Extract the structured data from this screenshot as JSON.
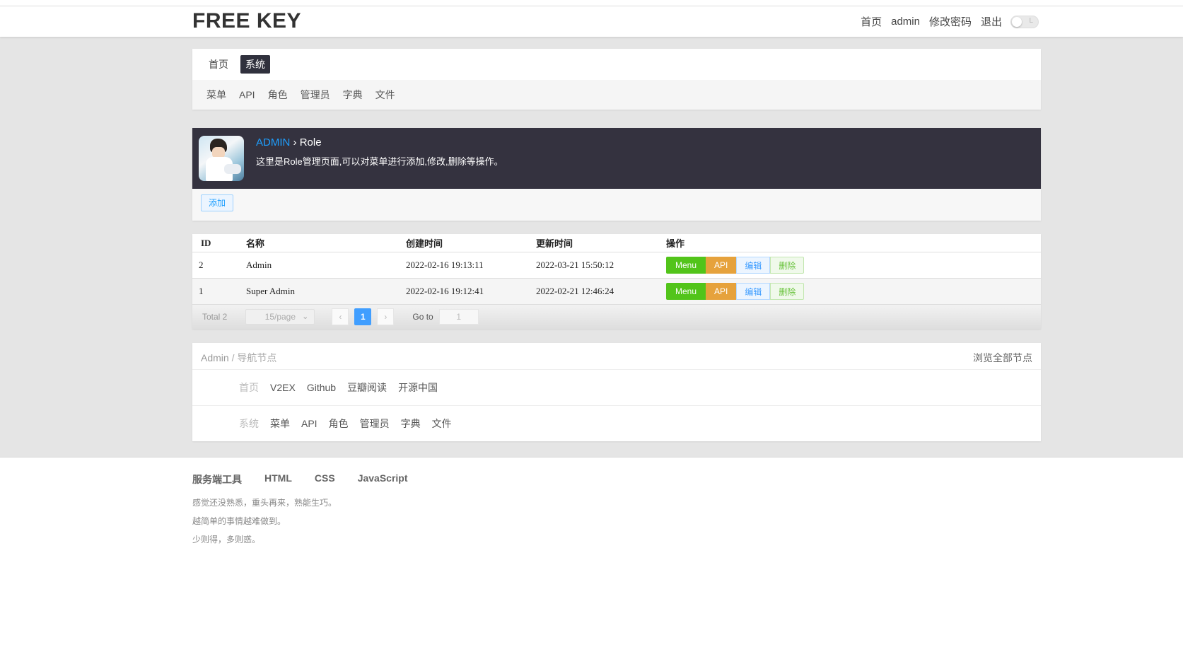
{
  "header": {
    "logo": "FREE KEY",
    "nav": [
      "首页",
      "admin",
      "修改密码",
      "退出"
    ],
    "toggle_label": "L"
  },
  "nav_primary": [
    {
      "label": "首页",
      "active": false
    },
    {
      "label": "系统",
      "active": true
    }
  ],
  "nav_secondary": [
    "菜单",
    "API",
    "角色",
    "管理员",
    "字典",
    "文件"
  ],
  "banner": {
    "crumb_root": "ADMIN",
    "crumb_sep": " › ",
    "crumb_current": "Role",
    "description": "这里是Role管理页面,可以对菜单进行添加,修改,删除等操作。"
  },
  "toolbar": {
    "add_label": "添加"
  },
  "table": {
    "columns": [
      "ID",
      "名称",
      "创建时间",
      "更新时间",
      "操作"
    ],
    "rows": [
      {
        "id": "2",
        "name": "Admin",
        "created": "2022-02-16 19:13:11",
        "updated": "2022-03-21 15:50:12"
      },
      {
        "id": "1",
        "name": "Super Admin",
        "created": "2022-02-16 19:12:41",
        "updated": "2022-02-21 12:46:24"
      }
    ],
    "actions": {
      "menu": "Menu",
      "api": "API",
      "edit": "编辑",
      "delete": "删除"
    }
  },
  "pagination": {
    "total": "Total 2",
    "page_size": "15/page",
    "current_page": "1",
    "goto_label": "Go to",
    "goto_value": "1"
  },
  "nodes": {
    "title_main": "Admin",
    "title_sep": " / ",
    "title_sub": "导航节点",
    "browse_all": "浏览全部节点",
    "row1": {
      "label": "首页",
      "items": [
        "V2EX",
        "Github",
        "豆瓣阅读",
        "开源中国"
      ]
    },
    "row2": {
      "label": "系统",
      "items": [
        "菜单",
        "API",
        "角色",
        "管理员",
        "字典",
        "文件"
      ]
    }
  },
  "footer": {
    "links": [
      "服务端工具",
      "HTML",
      "CSS",
      "JavaScript"
    ],
    "lines": [
      "感觉还没熟悉，重头再来，熟能生巧。",
      "越简单的事情越难做到。",
      "少则得，多则惑。"
    ]
  },
  "colors": {
    "accent_blue": "#1e9fff",
    "banner_bg": "#34323f",
    "menu_green": "#52c41a",
    "api_orange": "#e6a23c",
    "page_blue": "#409eff"
  }
}
